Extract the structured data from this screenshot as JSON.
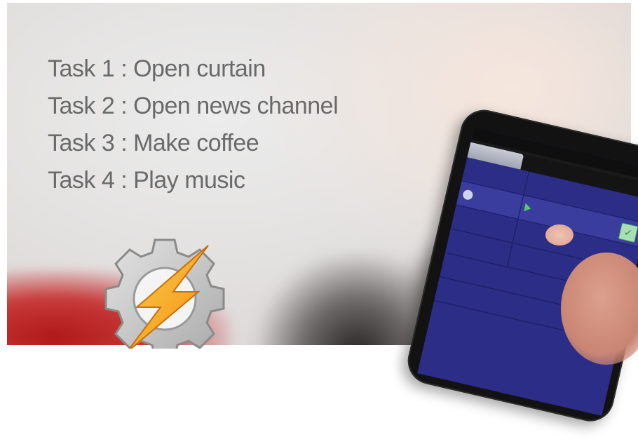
{
  "tasks": [
    "Task 1 : Open curtain",
    "Task 2 : Open news channel",
    "Task 3 : Make coffee",
    "Task 4 : Play music"
  ],
  "logo": {
    "icon": "gear-lightning-icon",
    "gear_color": "#c9c9c9",
    "bolt_color": "#f5a623"
  },
  "phone": {
    "screen_color": "#2b2d86",
    "status_accent": "#38b8e8",
    "play_icon": "play-icon",
    "check_icon": "check-icon"
  }
}
